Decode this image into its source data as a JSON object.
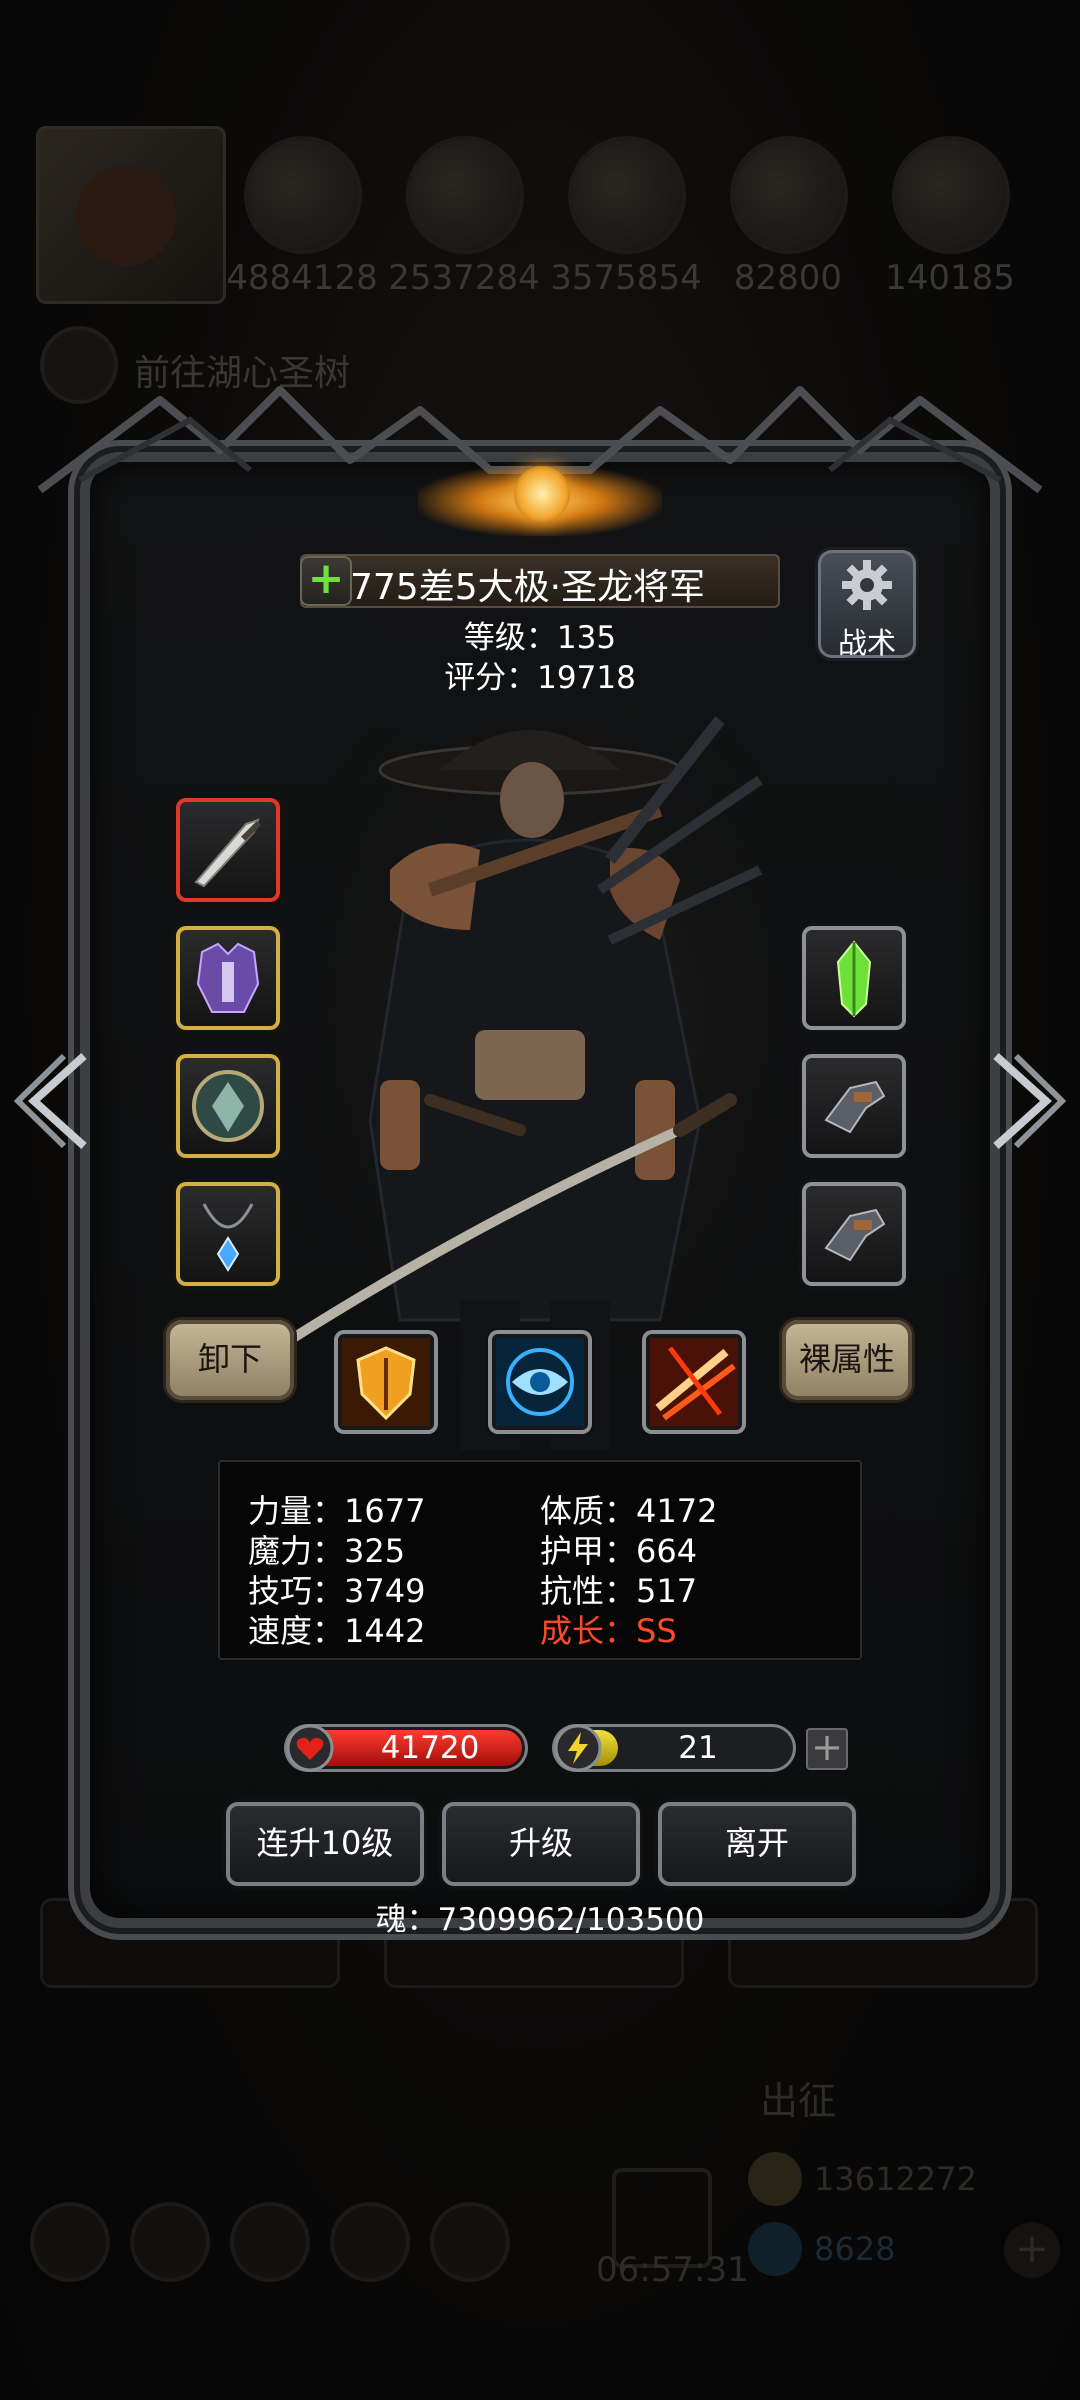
{
  "background": {
    "resources": [
      {
        "icon": "pumpkin-icon",
        "value": "4884128"
      },
      {
        "icon": "bread-icon",
        "value": "2537284"
      },
      {
        "icon": "ore-icon",
        "value": "3575854"
      },
      {
        "icon": "paw-icon",
        "value": "82800"
      },
      {
        "icon": "wood-icon",
        "value": "140185"
      }
    ],
    "goto_text": "前往湖心圣树",
    "expedition_label": "出征",
    "gold_amount": "13612272",
    "gem_amount": "8628",
    "timer": "06:57:31"
  },
  "hero": {
    "add_symbol": "+",
    "title": "775差5大极·圣龙将军",
    "level": "等级：135",
    "score": "评分：19718"
  },
  "tactics_label": "战术",
  "left_slots": [
    "greatsword-icon",
    "armor-icon",
    "shield-emblem-icon",
    "amulet-icon"
  ],
  "right_slots": [
    "green-crystal-icon",
    "gauntlet-icon",
    "gauntlet-icon"
  ],
  "unequip_label": "卸下",
  "base_attr_label": "裸属性",
  "skills": [
    "shield-skill-icon",
    "eye-skill-icon",
    "slash-skill-icon"
  ],
  "stats": {
    "strength": "力量：1677",
    "magic": "魔力：325",
    "skill": "技巧：3749",
    "speed": "速度：1442",
    "constitution": "体质：4172",
    "armor": "护甲：664",
    "resistance": "抗性：517",
    "growth": "成长：SS"
  },
  "hp": {
    "value": "41720",
    "fill": 1.0,
    "color": "#e3201a"
  },
  "energy": {
    "value": "21",
    "fill": 0.18,
    "color": "#e8d62e",
    "plus": "+"
  },
  "buttons": {
    "level_up_10": "连升10级",
    "level_up": "升级",
    "leave": "离开"
  },
  "soul": "魂：7309962/103500",
  "colors": {
    "growth": "#ff4a2a",
    "accent_gold": "#d2b043",
    "panel_border": "#4a4c50"
  }
}
